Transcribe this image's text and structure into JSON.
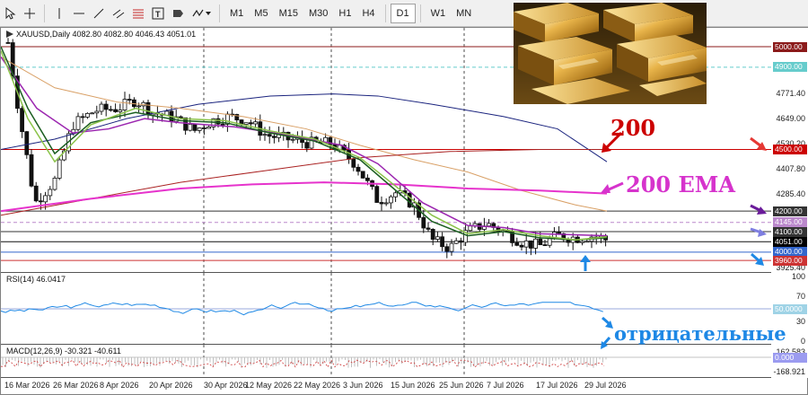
{
  "toolbar": {
    "timeframes": [
      "M1",
      "M5",
      "M15",
      "M30",
      "H1",
      "H4",
      "D1",
      "W1",
      "MN"
    ],
    "active_timeframe": "D1"
  },
  "chart": {
    "header": "XAUUSD,Daily 4082.80 4082.80 4046.43 4051.01",
    "price_ticks": [
      "4771.40",
      "4649.00",
      "4530.20",
      "4407.80",
      "4285.40",
      "3925.40"
    ],
    "levels": [
      {
        "label": "5000.00",
        "price": 5000,
        "color": "#8b1a1a"
      },
      {
        "label": "4900.00",
        "price": 4900,
        "color": "#66cccc"
      },
      {
        "label": "4500.00",
        "price": 4500,
        "color": "#cc0000"
      },
      {
        "label": "4200.00",
        "price": 4200,
        "color": "#333333"
      },
      {
        "label": "4145.00",
        "price": 4145,
        "color": "#bb88cc"
      },
      {
        "label": "4100.00",
        "price": 4100,
        "color": "#333333"
      },
      {
        "label": "4051.00",
        "price": 4051,
        "color": "#111111"
      },
      {
        "label": "4000.00",
        "price": 4000,
        "color": "#3366cc"
      },
      {
        "label": "3960.00",
        "price": 3960,
        "color": "#cc3333"
      }
    ],
    "time_labels": [
      "16 Mar 2026",
      "26 Mar 2026",
      "8 Apr 2026",
      "20 Apr 2026",
      "30 Apr 2026",
      "12 May 2026",
      "22 May 2026",
      "3 Jun 2026",
      "15 Jun 2026",
      "25 Jun 2026",
      "7 Jul 2026",
      "17 Jul 2026",
      "29 Jul 2026"
    ]
  },
  "rsi": {
    "label": "RSI(14) 46.0417",
    "ticks": [
      "100",
      "70",
      "30",
      "0"
    ],
    "level_tag": "50.0000"
  },
  "macd": {
    "label": "MACD(12,26,9) -30.321 -40.611",
    "ticks": [
      "162.583",
      "-168.921"
    ],
    "zero_tag": "0.000"
  },
  "annotations": {
    "ma200": "200",
    "ema200": "200 EMA",
    "negative": "отрицательные"
  },
  "colors": {
    "ema200": "#e633cc",
    "ma_blue": "#1a237e",
    "ma_orange": "#d9a066",
    "ma_red": "#aa2222",
    "ma_purple": "#9c27b0",
    "ma_green": "#1b5e20",
    "ma_lightgreen": "#8bc34a",
    "annotation_red": "#cc0000",
    "annotation_magenta": "#d633cc",
    "annotation_blue": "#1e88e5"
  }
}
